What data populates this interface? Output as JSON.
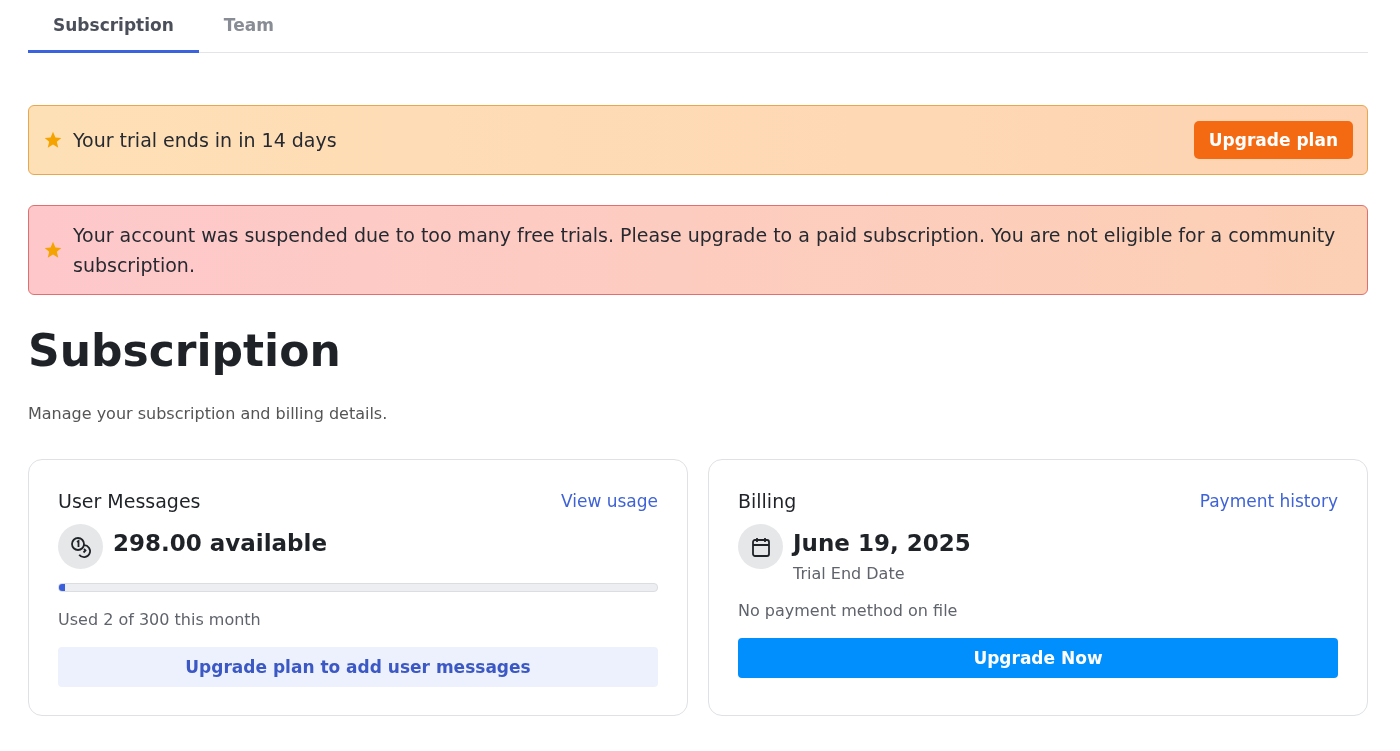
{
  "tabs": [
    {
      "label": "Subscription",
      "selected": true
    },
    {
      "label": "Team",
      "selected": false
    }
  ],
  "banners": [
    {
      "kind": "warning",
      "text": "Your trial ends in in 14 days",
      "button": "Upgrade plan"
    },
    {
      "kind": "error",
      "text": "Your account was suspended due to too many free trials. Please upgrade to a paid subscription. You are not eligible for a community subscription."
    }
  ],
  "heading": "Subscription",
  "subtitle": "Manage your subscription and billing details.",
  "cards": [
    {
      "kind": "usage",
      "title": "User Messages",
      "link": "View usage",
      "value": "298.00 available",
      "level": 0.01,
      "note": "Used 2 of 300 this month",
      "button": "Upgrade plan to add user messages"
    },
    {
      "kind": "billing",
      "title": "Billing",
      "link": "Payment history",
      "value": "June 19, 2025",
      "caption": "Trial End Date",
      "note": "No payment method on file",
      "button": "Upgrade Now"
    }
  ]
}
